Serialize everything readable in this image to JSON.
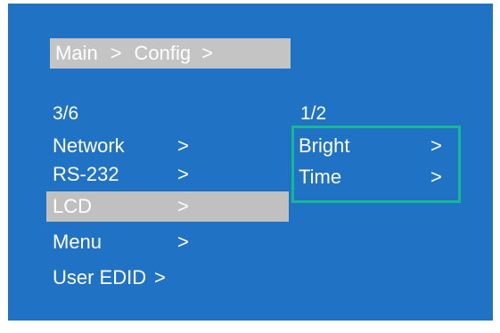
{
  "breadcrumb": {
    "items": [
      "Main",
      ">",
      "Config",
      ">"
    ]
  },
  "left_menu": {
    "counter": "3/6",
    "items": [
      {
        "label": "Network",
        "arrow": ">"
      },
      {
        "label": "RS-232",
        "arrow": ">"
      },
      {
        "label": "LCD",
        "arrow": ">",
        "selected": true
      },
      {
        "label": "Menu",
        "arrow": ">"
      },
      {
        "label": "User EDID",
        "arrow": ">"
      }
    ]
  },
  "right_menu": {
    "counter": "1/2",
    "items": [
      {
        "label": "Bright",
        "arrow": ">"
      },
      {
        "label": "Time",
        "arrow": ">"
      }
    ]
  },
  "colors": {
    "screen_bg": "#1f72c4",
    "selection_bg": "#c0c0c0",
    "highlight_border": "#17b896",
    "text": "#ffffff"
  }
}
